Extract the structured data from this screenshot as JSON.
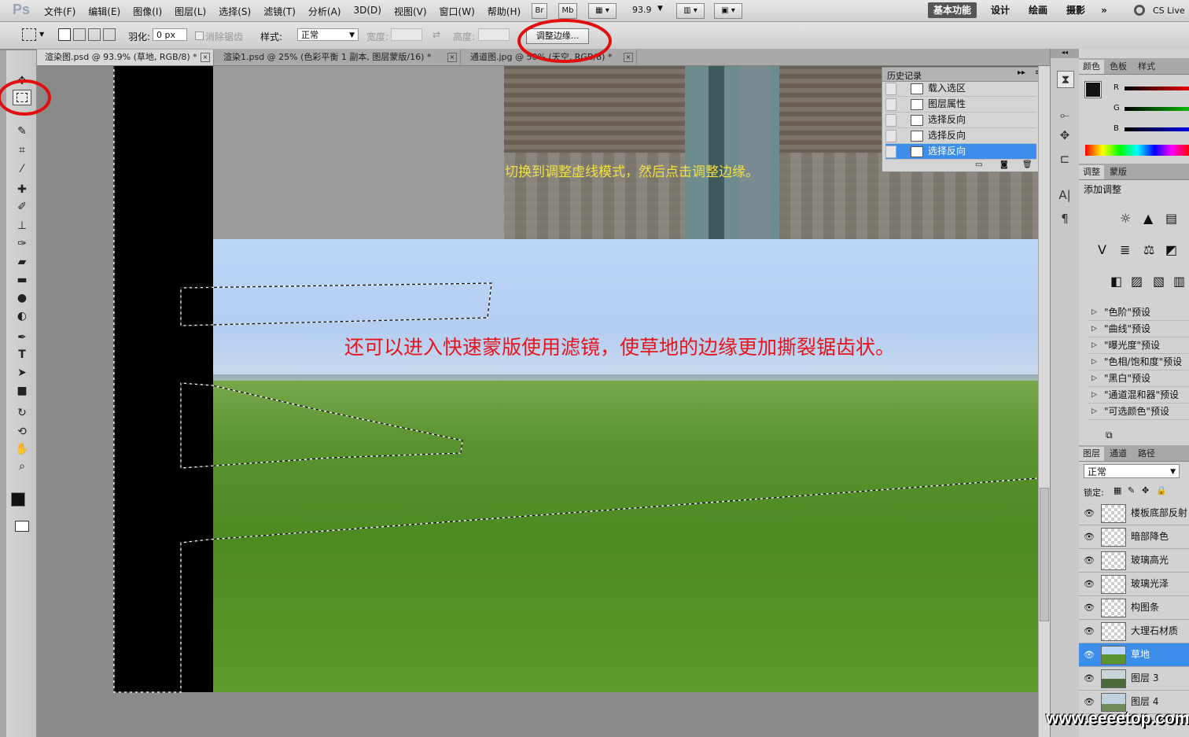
{
  "app": {
    "logo": "Ps"
  },
  "menu": [
    "文件(F)",
    "编辑(E)",
    "图像(I)",
    "图层(L)",
    "选择(S)",
    "滤镜(T)",
    "分析(A)",
    "3D(D)",
    "视图(V)",
    "窗口(W)",
    "帮助(H)"
  ],
  "appbar": {
    "br": "Br",
    "mb": "Mb",
    "zoom": "93.9"
  },
  "workspaces": [
    "基本功能",
    "设计",
    "绘画",
    "摄影"
  ],
  "cslive": "CS Live",
  "options": {
    "feather_label": "羽化:",
    "feather_value": "0 px",
    "antialias_label": "消除锯齿",
    "style_label": "样式:",
    "style_value": "正常",
    "width_label": "宽度:",
    "height_label": "高度:",
    "refine_edge_button": "调整边缘..."
  },
  "doc_tabs": [
    {
      "label": "渲染图.psd @ 93.9% (草地, RGB/8) *",
      "active": true
    },
    {
      "label": "渲染1.psd @ 25% (色彩平衡 1 副本, 图层蒙版/16) *",
      "active": false
    },
    {
      "label": "通道图.jpg @ 50% (天空, RGB/8) *",
      "active": false
    }
  ],
  "annotations": {
    "top": "切换到调整虚线模式，然后点击调整边缘。",
    "middle": "还可以进入快速蒙版使用滤镜，使草地的边缘更加撕裂锯齿状。"
  },
  "history": {
    "title": "历史记录",
    "items": [
      {
        "label": "载入选区",
        "selected": false
      },
      {
        "label": "图层属性",
        "selected": false
      },
      {
        "label": "选择反向",
        "selected": false
      },
      {
        "label": "选择反向",
        "selected": false
      },
      {
        "label": "选择反向",
        "selected": true
      }
    ]
  },
  "color_panel": {
    "tabs": [
      "颜色",
      "色板",
      "样式"
    ],
    "channels": [
      "R",
      "G",
      "B"
    ]
  },
  "adjust_panel": {
    "tabs": [
      "调整",
      "蒙版"
    ],
    "heading": "添加调整",
    "presets": [
      "\"色阶\"预设",
      "\"曲线\"预设",
      "\"曝光度\"预设",
      "\"色相/饱和度\"预设",
      "\"黑白\"预设",
      "\"通道混和器\"预设",
      "\"可选颜色\"预设"
    ]
  },
  "layers_panel": {
    "tabs": [
      "图层",
      "通道",
      "路径"
    ],
    "blend_mode": "正常",
    "lock_label": "锁定:",
    "layers": [
      {
        "name": "楼板底部反射",
        "selected": false
      },
      {
        "name": "暗部降色",
        "selected": false
      },
      {
        "name": "玻璃高光",
        "selected": false
      },
      {
        "name": "玻璃光泽",
        "selected": false
      },
      {
        "name": "构图条",
        "selected": false
      },
      {
        "name": "大理石材质",
        "selected": false
      },
      {
        "name": "草地",
        "selected": true
      },
      {
        "name": "图层 3",
        "selected": false
      },
      {
        "name": "图层 4",
        "selected": false
      }
    ]
  },
  "watermark": "www.eeeetop.com",
  "colors": {
    "accent": "#3d8eea",
    "annotation_red": "#e8141c",
    "annotation_yellow": "#f0e040",
    "circle": "#e01010"
  },
  "icons": [
    "move-icon",
    "marquee-icon",
    "quick-select-icon",
    "crop-icon",
    "eyedropper-icon",
    "heal-icon",
    "brush-icon",
    "stamp-icon",
    "history-brush-icon",
    "eraser-icon",
    "gradient-icon",
    "blur-icon",
    "dodge-icon",
    "pen-icon",
    "type-icon",
    "path-select-icon",
    "shape-icon",
    "3d-rotate-icon",
    "3d-orbit-icon",
    "hand-icon",
    "zoom-icon"
  ]
}
